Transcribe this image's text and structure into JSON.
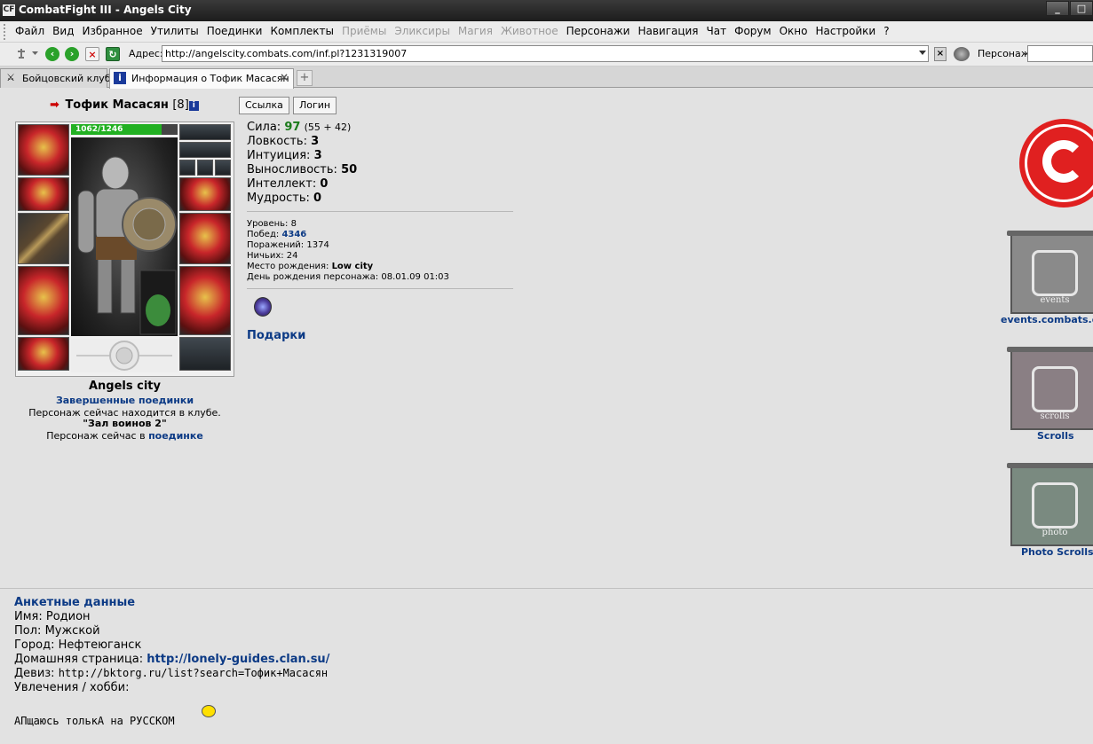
{
  "window": {
    "app_icon": "CF",
    "title": "CombatFight III - Angels City",
    "buttons": [
      "_",
      "□"
    ]
  },
  "menu": {
    "items": [
      {
        "label": "Файл",
        "enabled": true
      },
      {
        "label": "Вид",
        "enabled": true
      },
      {
        "label": "Избранное",
        "enabled": true
      },
      {
        "label": "Утилиты",
        "enabled": true
      },
      {
        "label": "Поединки",
        "enabled": true
      },
      {
        "label": "Комплекты",
        "enabled": true
      },
      {
        "label": "Приёмы",
        "enabled": false
      },
      {
        "label": "Эликсиры",
        "enabled": false
      },
      {
        "label": "Магия",
        "enabled": false
      },
      {
        "label": "Животное",
        "enabled": false
      },
      {
        "label": "Персонажи",
        "enabled": true
      },
      {
        "label": "Навигация",
        "enabled": true
      },
      {
        "label": "Чат",
        "enabled": true
      },
      {
        "label": "Форум",
        "enabled": true
      },
      {
        "label": "Окно",
        "enabled": true
      },
      {
        "label": "Настройки",
        "enabled": true
      },
      {
        "label": "?",
        "enabled": true
      }
    ]
  },
  "toolbar": {
    "address_label": "Адрес:",
    "address_value": "http://angelscity.combats.com/inf.pl?1231319007",
    "character_label": "Персонаж:",
    "character_value": "",
    "icons": [
      "pin-icon",
      "back-icon",
      "forward-icon",
      "stop-icon",
      "refresh-icon"
    ]
  },
  "tabs": [
    {
      "label": "Бойцовский клуб",
      "active": false
    },
    {
      "label": "Информация о Тофик Масасян",
      "active": true
    }
  ],
  "tab_add_label": "+",
  "character": {
    "arrow": "➡",
    "name": "Тофик Масасян",
    "level": "[8]",
    "info_icon": "i",
    "hp_text": "1062/1246",
    "hp_fraction": 0.852,
    "city": "Angels city",
    "fights_link": "Завершенные поединки",
    "club_line": "Персонаж сейчас находится в клубе.",
    "room": "\"Зал воинов 2\"",
    "battle_prefix": "Персонаж сейчас в",
    "battle_link": "поединке"
  },
  "buttons": {
    "link": "Ссылка",
    "login": "Логин"
  },
  "stats": {
    "strength_label": "Сила:",
    "strength_value": "97",
    "strength_detail": "(55 + 42)",
    "agility_label": "Ловкость:",
    "agility_value": "3",
    "intuition_label": "Интуиция:",
    "intuition_value": "3",
    "endurance_label": "Выносливость:",
    "endurance_value": "50",
    "intellect_label": "Интеллект:",
    "intellect_value": "0",
    "wisdom_label": "Мудрость:",
    "wisdom_value": "0"
  },
  "info": {
    "level_label": "Уровень:",
    "level_value": "8",
    "wins_label": "Побед:",
    "wins_value": "4346",
    "losses_label": "Поражений:",
    "losses_value": "1374",
    "draws_label": "Ничьих:",
    "draws_value": "24",
    "birthplace_label": "Место рождения:",
    "birthplace_value": "Low city",
    "birthday_label": "День рождения персонажа:",
    "birthday_value": "08.01.09 01:03"
  },
  "gifts_label": "Подарки",
  "sidebar": {
    "banners": [
      {
        "caption": "events",
        "label": "events.combats.c"
      },
      {
        "caption": "scrolls",
        "label": "Scrolls"
      },
      {
        "caption": "photo",
        "label": "Photo Scrolls"
      }
    ]
  },
  "profile": {
    "heading": "Анкетные данные",
    "name_label": "Имя:",
    "name_value": "Родион",
    "gender_label": "Пол:",
    "gender_value": "Мужской",
    "city_label": "Город:",
    "city_value": "Нефтеюганск",
    "homepage_label": "Домашняя страница:",
    "homepage_value": "http://lonely-guides.clan.su/",
    "motto_label": "Девиз:",
    "motto_value": "http://bktorg.ru/list?search=Тофик+Масасян",
    "hobby_label": "Увлечения / хобби:",
    "hobby_value": "АПщаюсь толькА на РУССКОМ"
  },
  "colors": {
    "link": "#0c3a85",
    "stat_highlight": "#1a7a1a",
    "hp_bar": "#22b022",
    "logo_red": "#e02020",
    "page_bg": "#e2e2e2"
  }
}
